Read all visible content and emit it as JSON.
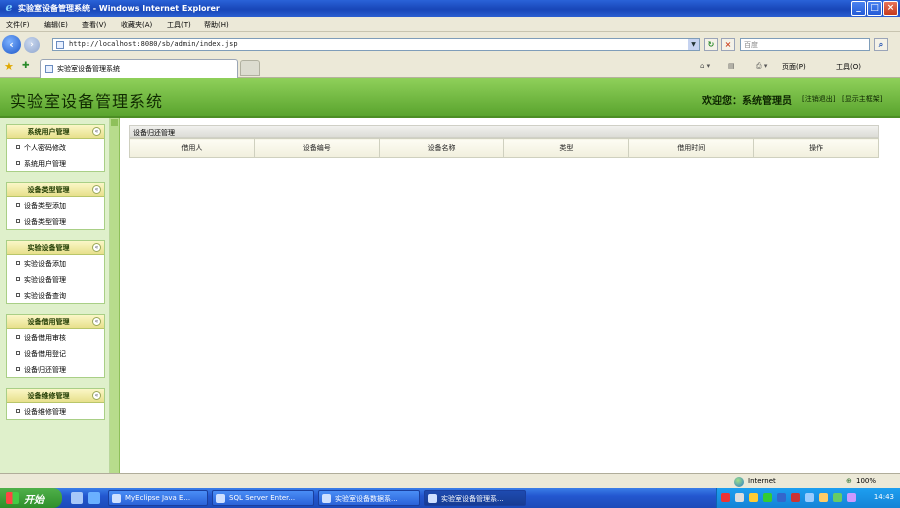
{
  "window": {
    "title": "实验室设备管理系统 - Windows Internet Explorer"
  },
  "menu": [
    "文件(F)",
    "编辑(E)",
    "查看(V)",
    "收藏夹(A)",
    "工具(T)",
    "帮助(H)"
  ],
  "address": {
    "url": "http://localhost:8080/sb/admin/index.jsp"
  },
  "search": {
    "placeholder": "百度"
  },
  "tab": {
    "label": "实验室设备管理系统"
  },
  "toolbar": {
    "page_label": "页面(P)",
    "tools_label": "工具(O)"
  },
  "header": {
    "system_name": "实验室设备管理系统",
    "welcome": "欢迎您：系统管理员",
    "logout": "[注销退出]",
    "home": "[显示主框架]"
  },
  "sidebar": {
    "groups": [
      {
        "title": "系统用户管理",
        "items": [
          "个人密码修改",
          "系统用户管理"
        ]
      },
      {
        "title": "设备类型管理",
        "items": [
          "设备类型添加",
          "设备类型管理"
        ]
      },
      {
        "title": "实验设备管理",
        "items": [
          "实验设备添加",
          "实验设备管理",
          "实验设备查询"
        ]
      },
      {
        "title": "设备借用管理",
        "items": [
          "设备借用审核",
          "设备借用登记",
          "设备归还管理"
        ]
      },
      {
        "title": "设备维修管理",
        "items": [
          "设备维修管理"
        ]
      }
    ]
  },
  "main": {
    "panel_title": "设备归还管理",
    "columns": [
      "借用人",
      "设备编号",
      "设备名称",
      "类型",
      "借用时间",
      "操作"
    ]
  },
  "status": {
    "zone": "Internet",
    "zoom": "100%"
  },
  "taskbar": {
    "start": "开始",
    "tasks": [
      "MyEclipse Java E...",
      "SQL Server Enter...",
      "实验室设备数据系...",
      "实验室设备管理系..."
    ],
    "clock": "14:43"
  },
  "colors": {
    "header_green": "#6fb83c",
    "sidebar_bg": "#dff0cb",
    "ie_blue": "#1846b8"
  }
}
